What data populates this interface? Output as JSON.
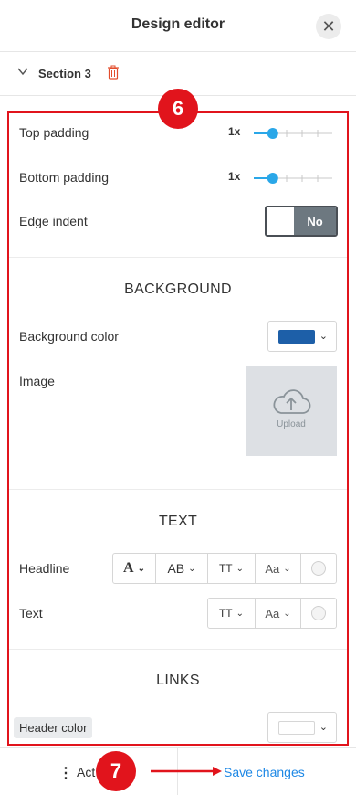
{
  "header": {
    "title": "Design editor",
    "close_icon": "close-icon"
  },
  "section": {
    "label": "Section 3",
    "collapse_icon": "chevron-down-icon",
    "delete_icon": "trash-icon",
    "delete_color": "#e34d2c"
  },
  "spacing": {
    "top_padding": {
      "label": "Top padding",
      "value": "1x",
      "level": 0.2
    },
    "bottom_padding": {
      "label": "Bottom padding",
      "value": "1x",
      "level": 0.2
    },
    "edge_indent": {
      "label": "Edge indent",
      "value": "No"
    }
  },
  "background": {
    "title": "BACKGROUND",
    "color_label": "Background color",
    "color_value": "#1d5fa8",
    "image_label": "Image",
    "upload_label": "Upload"
  },
  "text": {
    "title": "TEXT",
    "headline_label": "Headline",
    "text_label": "Text",
    "tools": {
      "bold": "A",
      "caps": "AB",
      "size": "TT",
      "font": "Aa"
    }
  },
  "links": {
    "title": "LINKS",
    "header_color_label": "Header color",
    "header_color_value": "#ffffff"
  },
  "markers": {
    "panel": "6",
    "footer": "7",
    "color": "#e1141c"
  },
  "footer": {
    "actions_label": "Act",
    "save_label": "Save changes",
    "accent": "#1e88e5"
  }
}
